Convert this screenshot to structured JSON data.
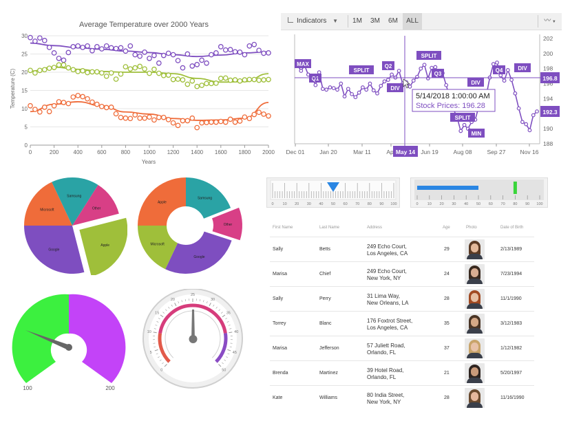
{
  "colors": {
    "purple": "#7e4ec0",
    "green": "#9fbf3a",
    "orange": "#ef6c3a",
    "teal": "#2aa3a5",
    "magenta": "#d83f86",
    "stock": "#7e4ec0",
    "pointer": "#2a86e3",
    "bullet": "#2a86e3",
    "bullet_target": "#39d53a",
    "gauge_green": "#3cf03f",
    "gauge_purple": "#c343f8"
  },
  "temperature_chart": {
    "title": "Average Temperature over 2000 Years",
    "xlabel": "Years",
    "ylabel": "Temperature (C)",
    "x_ticks": [
      "0",
      "200",
      "400",
      "600",
      "800",
      "1000",
      "1200",
      "1400",
      "1600",
      "1800",
      "2000"
    ],
    "y_ticks": [
      "0",
      "5",
      "10",
      "15",
      "20",
      "25",
      "30"
    ]
  },
  "stock_chart": {
    "toolbar": {
      "indicators_label": "Indicators",
      "ranges": [
        "1M",
        "3M",
        "6M",
        "ALL"
      ],
      "active_range": "ALL"
    },
    "x_ticks": [
      "Dec 01",
      "Jan 20",
      "Mar 11",
      "Apr",
      "Jun 19",
      "Aug 08",
      "Sep 27",
      "Nov 16"
    ],
    "y_ticks": [
      "188",
      "190",
      "192",
      "194",
      "196",
      "198",
      "200",
      "202"
    ],
    "crosshair_x_label": "May 14",
    "crosshair_y_label": "196.8",
    "last_value_label": "192.3",
    "tooltip_date": "5/14/2018 1:00:00 AM",
    "tooltip_value": "Stock Prices: 196.28",
    "annotations": [
      "MAX",
      "Q1",
      "SPLIT",
      "Q2",
      "DIV",
      "SPLIT",
      "Q3",
      "DIV",
      "Q4",
      "DIV",
      "SPLIT",
      "MIN"
    ]
  },
  "pie_chart_1": {
    "slices": [
      "Microsoft",
      "Samsung",
      "Other",
      "Apple",
      "Google"
    ]
  },
  "pie_chart_2": {
    "slices": [
      "Samsung",
      "Other",
      "Google",
      "Microsoft",
      "Apple"
    ]
  },
  "linear_gauge": {
    "ticks": [
      "0",
      "10",
      "20",
      "30",
      "40",
      "50",
      "60",
      "70",
      "80",
      "90",
      "100"
    ],
    "value": 50
  },
  "bullet_graph": {
    "ticks": [
      "0",
      "10",
      "20",
      "30",
      "40",
      "50",
      "60",
      "70",
      "80",
      "90",
      "100"
    ],
    "value": 50,
    "target": 80
  },
  "radial_gauge_1": {
    "min_label": "100",
    "max_label": "200"
  },
  "radial_gauge_2": {
    "ticks": [
      "0",
      "5",
      "10",
      "15",
      "20",
      "25",
      "30",
      "35",
      "40",
      "45",
      "50"
    ]
  },
  "grid": {
    "headers": [
      "First Name",
      "Last Name",
      "Address",
      "Age",
      "Photo",
      "Date of Birth"
    ],
    "rows": [
      {
        "first": "Sally",
        "last": "Betts",
        "addr1": "249 Echo Court,",
        "addr2": "Los Angeles, CA",
        "age": "29",
        "dob": "2/13/1989"
      },
      {
        "first": "Marisa",
        "last": "Chief",
        "addr1": "249 Echo Court,",
        "addr2": "New York, NY",
        "age": "24",
        "dob": "7/23/1994"
      },
      {
        "first": "Sally",
        "last": "Perry",
        "addr1": "31 Lima Way,",
        "addr2": "New Orleans, LA",
        "age": "28",
        "dob": "11/1/1990"
      },
      {
        "first": "Torrey",
        "last": "Blanc",
        "addr1": "176 Foxtrot Street,",
        "addr2": "Los Angeles, CA",
        "age": "35",
        "dob": "3/12/1983"
      },
      {
        "first": "Marisa",
        "last": "Jefferson",
        "addr1": "57 Juliett Road,",
        "addr2": "Orlando, FL",
        "age": "37",
        "dob": "1/12/1982"
      },
      {
        "first": "Brenda",
        "last": "Martinez",
        "addr1": "39 Hotel Road,",
        "addr2": "Orlando, FL",
        "age": "21",
        "dob": "5/20/1997"
      },
      {
        "first": "Kate",
        "last": "Williams",
        "addr1": "80 India Street,",
        "addr2": "New York, NY",
        "age": "28",
        "dob": "11/16/1990"
      }
    ]
  },
  "chart_data": [
    {
      "type": "scatter",
      "title": "Average Temperature over 2000 Years",
      "xlabel": "Years",
      "ylabel": "Temperature (C)",
      "xlim": [
        0,
        2000
      ],
      "ylim": [
        0,
        30
      ],
      "series": [
        {
          "color": "#7e4ec0",
          "x": [
            0,
            40,
            80,
            120,
            160,
            200,
            240,
            280,
            320,
            360,
            400,
            440,
            480,
            520,
            560,
            600,
            640,
            680,
            720,
            760,
            800,
            840,
            880,
            920,
            960,
            1000,
            1040,
            1080,
            1120,
            1160,
            1200,
            1240,
            1280,
            1320,
            1360,
            1400,
            1440,
            1480,
            1520,
            1560,
            1600,
            1640,
            1680,
            1720,
            1760,
            1800,
            1840,
            1880,
            1920,
            1960,
            2000
          ],
          "y": [
            29.5,
            28.5,
            29.4,
            28.7,
            26.8,
            25.3,
            23.8,
            23.3,
            25.4,
            27,
            27.2,
            26.8,
            27.2,
            25.9,
            27,
            26.4,
            27.2,
            26.7,
            26.5,
            26.7,
            25.8,
            27.2,
            24.8,
            24.4,
            25.5,
            23.8,
            24.6,
            22.5,
            24.6,
            25.2,
            24.8,
            23.2,
            21.2,
            25,
            21.7,
            22.1,
            23.3,
            22.5,
            24.8,
            25.3,
            27,
            26.1,
            26.2,
            25.6,
            25.5,
            24.8,
            27.2,
            27.6,
            26,
            25.2,
            25.3
          ]
        },
        {
          "color": "#9fbf3a",
          "x": [
            0,
            40,
            80,
            120,
            160,
            200,
            240,
            280,
            320,
            360,
            400,
            440,
            480,
            520,
            560,
            600,
            640,
            680,
            720,
            760,
            800,
            840,
            880,
            920,
            960,
            1000,
            1040,
            1080,
            1120,
            1160,
            1200,
            1240,
            1280,
            1320,
            1360,
            1400,
            1440,
            1480,
            1520,
            1560,
            1600,
            1640,
            1680,
            1720,
            1760,
            1800,
            1840,
            1880,
            1920,
            1960,
            2000
          ],
          "y": [
            20.5,
            19.8,
            20.5,
            20.7,
            21.1,
            21.3,
            22,
            22,
            21.2,
            20.7,
            20.2,
            20.4,
            19.9,
            20.1,
            20.1,
            19.8,
            18.9,
            19.8,
            18.1,
            19.5,
            21.5,
            20.9,
            21.2,
            21.6,
            20.9,
            19.7,
            20.8,
            19.7,
            19.1,
            19.2,
            18,
            18.1,
            17.9,
            16.7,
            17.6,
            16.1,
            16.4,
            16.9,
            16.9,
            17,
            18.3,
            18.4,
            17.8,
            17.9,
            17.6,
            17.9,
            18,
            18,
            17.8,
            17.9,
            18
          ]
        },
        {
          "color": "#ef6c3a",
          "x": [
            0,
            40,
            80,
            120,
            160,
            200,
            240,
            280,
            320,
            360,
            400,
            440,
            480,
            520,
            560,
            600,
            640,
            680,
            720,
            760,
            800,
            840,
            880,
            920,
            960,
            1000,
            1040,
            1080,
            1120,
            1160,
            1200,
            1240,
            1280,
            1320,
            1360,
            1400,
            1440,
            1480,
            1520,
            1560,
            1600,
            1640,
            1680,
            1720,
            1760,
            1800,
            1840,
            1880,
            1920,
            1960,
            2000
          ],
          "y": [
            10.8,
            9.8,
            9.1,
            10.4,
            9.2,
            10.8,
            11.9,
            11.7,
            11.4,
            13.2,
            13.6,
            13.3,
            12.7,
            11.8,
            11.2,
            10.6,
            10.3,
            10.4,
            8.6,
            7.6,
            7.4,
            7.3,
            8.3,
            7.4,
            7.4,
            7.7,
            6.9,
            7.6,
            7.6,
            7,
            6.1,
            5.4,
            6.7,
            6.7,
            7.4,
            4.8,
            6.1,
            6.2,
            6.3,
            6.3,
            6.5,
            6.3,
            7.1,
            6.3,
            6.6,
            7.7,
            7.3,
            8.4,
            9,
            8.5,
            8
          ]
        }
      ],
      "trend_lines": [
        {
          "color": "#7e4ec0",
          "x": [
            0,
            200,
            400,
            600,
            800,
            1000,
            1200,
            1400,
            1600,
            1800,
            2000
          ],
          "y": [
            28,
            27.3,
            26.7,
            26.3,
            25.8,
            25.4,
            24.8,
            24.3,
            24.7,
            25.3,
            25.6
          ]
        },
        {
          "color": "#9fbf3a",
          "x": [
            0,
            200,
            400,
            600,
            800,
            1000,
            1200,
            1400,
            1600,
            1800,
            2000
          ],
          "y": [
            20.3,
            21.4,
            20.8,
            20.2,
            20,
            20,
            19.6,
            18.3,
            17.3,
            17.4,
            19.6
          ]
        },
        {
          "color": "#ef6c3a",
          "x": [
            0,
            200,
            400,
            600,
            800,
            1000,
            1200,
            1400,
            1600,
            1800,
            2000
          ],
          "y": [
            9.2,
            11.2,
            11.9,
            10.8,
            9.1,
            8.5,
            7.3,
            6.8,
            6.9,
            7.4,
            11.7
          ]
        }
      ]
    },
    {
      "type": "line",
      "title": "",
      "ylim": [
        188,
        202
      ],
      "x": [
        "Dec 01",
        "Jan 20",
        "Mar 11",
        "Apr",
        "Jun 19",
        "Aug 08",
        "Sep 27",
        "Nov 16"
      ],
      "series": [
        {
          "name": "Stock Prices",
          "color": "#7e4ec0",
          "y": [
            198.5,
            197.7,
            198.4,
            197.2,
            196.8,
            195.8,
            197.5,
            195.3,
            195.2,
            195.5,
            195.4,
            195.2,
            196,
            194.3,
            195.3,
            194.6,
            194.2,
            194.8,
            195.5,
            195.2,
            196,
            195.1,
            194.7,
            195.7,
            196.3,
            196.5,
            197.2,
            196.8,
            197.7,
            196,
            196.2,
            195.6,
            196.4,
            196.9,
            198,
            198.5,
            196.7,
            198.1,
            198.2,
            197.1,
            197.4,
            195.8,
            194,
            192.6,
            191.5,
            189.7,
            190.5,
            190,
            190.9,
            191.2,
            193,
            193,
            194.3,
            196.8,
            198.6,
            198.8,
            197.1,
            196.4,
            197.8,
            196.5,
            194.7,
            192.7,
            190.9,
            190.6,
            189.8,
            191.8,
            192.3
          ]
        }
      ]
    },
    {
      "type": "pie",
      "labels": [
        "Microsoft",
        "Samsung",
        "Other",
        "Apple",
        "Google"
      ],
      "values": [
        18,
        16,
        12,
        25,
        29
      ]
    },
    {
      "type": "pie",
      "labels": [
        "Samsung",
        "Other",
        "Google",
        "Microsoft",
        "Apple"
      ],
      "values": [
        19,
        11,
        27,
        18,
        25
      ]
    }
  ]
}
